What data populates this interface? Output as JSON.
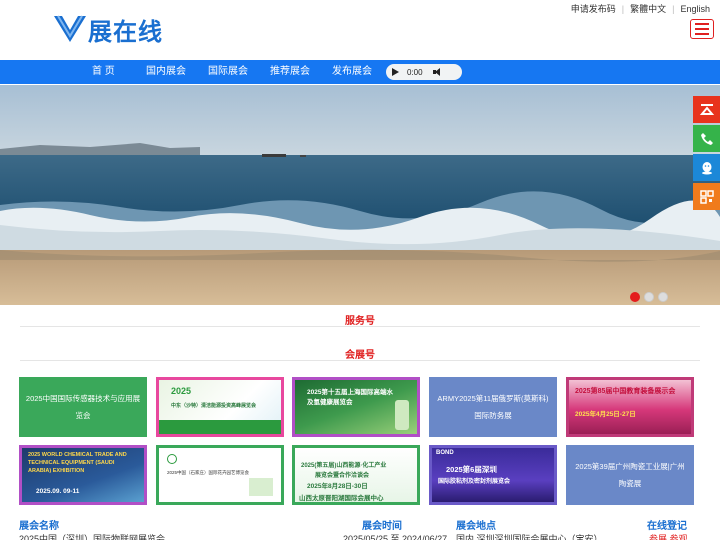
{
  "header": {
    "logo_text": "展在线",
    "top_links": [
      "申请发布码",
      "繁體中文",
      "English"
    ]
  },
  "nav": {
    "items": [
      "首 页",
      "国内展会",
      "国际展会",
      "推荐展会",
      "发布展会"
    ],
    "audio_time": "0:00"
  },
  "banner": {
    "slide_count": 3,
    "active_slide": 1
  },
  "float_bar": {
    "icons": [
      "back-to-top-icon",
      "phone-icon",
      "qq-icon",
      "qrcode-icon"
    ],
    "colors": [
      "#e8331d",
      "#35b34a",
      "#1c88d8",
      "#f07b1c"
    ]
  },
  "sections": {
    "service_title": "服务号",
    "exhibition_title": "会展号"
  },
  "tiles": [
    {
      "type": "text",
      "text": "2025中国国际传感器技术与应用展览会",
      "color": "#3aa85a"
    },
    {
      "type": "image",
      "lines": [
        "2025",
        "中东（沙特）清洁能源投资高峰展览会"
      ],
      "color": "#e8489e"
    },
    {
      "type": "image",
      "lines": [
        "2025第十五届上海国际高端水",
        "及氢健康展览会"
      ],
      "color": "#b14fc6"
    },
    {
      "type": "text",
      "text": "ARMY2025第11届俄罗斯(莫斯科)国际防务展",
      "color": "#6a88c8"
    },
    {
      "type": "image",
      "lines": [
        "2025第85届中国教育装备展示会",
        "2025年4月25日-27日"
      ],
      "color": "#c03a78"
    },
    {
      "type": "image",
      "lines": [
        "2025 WORLD CHEMICAL TRADE AND",
        "TECHNICAL EQUIPMENT (SAUDI",
        "ARABIA) EXHIBITION",
        "2025.09. 09-11"
      ],
      "color": "#b14fc6"
    },
    {
      "type": "image",
      "lines": [
        "2025中国（石家庄）国际花卉园艺博览会"
      ],
      "color": "#3aa85a"
    },
    {
      "type": "image",
      "lines": [
        "2025(第五届)山西能源·化工产业",
        "展览会暨合作洽谈会",
        "2025年8月28日-30日",
        "山西太原晋阳湖国际会展中心"
      ],
      "color": "#3aa85a"
    },
    {
      "type": "image",
      "lines": [
        "BOND",
        "2025第6届深圳",
        "国际胶粘剂及密封剂展览会"
      ],
      "color": "#6a5ac8"
    },
    {
      "type": "text",
      "text": "2025第39届广州陶瓷工业展|广州陶瓷展",
      "color": "#6a88c8"
    }
  ],
  "table": {
    "headers": [
      "展会名称",
      "展会时间",
      "展会地点",
      "在线登记"
    ],
    "first_row": {
      "name": "2025中国（深圳）国际物联网展览会",
      "time": "2025/05/25 至 2024/06/27",
      "place": "国内  深圳深圳国际会展中心（宝安）",
      "action": "参展 参观"
    }
  }
}
